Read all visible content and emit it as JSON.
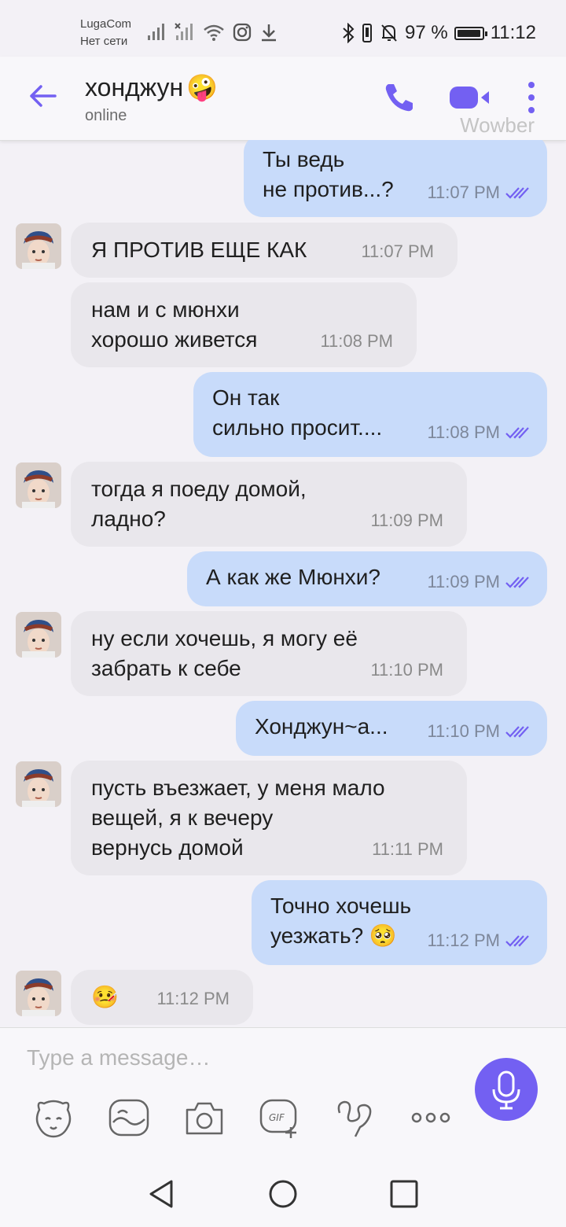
{
  "status_bar": {
    "carrier": "LugaCom",
    "network": "Нет сети",
    "battery_percent": "97 %",
    "battery_level": 0.97,
    "time": "11:12"
  },
  "header": {
    "contact_name": "хонджун",
    "name_emoji": "🤪",
    "status": "online",
    "watermark": "Wowber",
    "accent_color": "#7360f2"
  },
  "messages": [
    {
      "dir": "out",
      "text": "Ты ведь\nне против...?",
      "time": "11:07 PM",
      "read": true
    },
    {
      "dir": "in",
      "text": "Я ПРОТИВ ЕЩЕ КАК",
      "time": "11:07 PM",
      "avatar": true
    },
    {
      "dir": "in",
      "text": "нам и с мюнхи\nхорошо живется",
      "time": "11:08 PM",
      "avatar": false
    },
    {
      "dir": "out",
      "text": "Он так\nсильно просит....",
      "time": "11:08 PM",
      "read": true
    },
    {
      "dir": "in",
      "text": "тогда я поеду домой,\nладно?",
      "time": "11:09 PM",
      "avatar": true
    },
    {
      "dir": "out",
      "text": "А как же Мюнхи?",
      "time": "11:09 PM",
      "read": true
    },
    {
      "dir": "in",
      "text": "ну если хочешь, я могу её\nзабрать к себе",
      "time": "11:10 PM",
      "avatar": true
    },
    {
      "dir": "out",
      "text": "Хонджун~а...",
      "time": "11:10 PM",
      "read": true
    },
    {
      "dir": "in",
      "text": "пусть въезжает, у меня мало\nвещей, я к вечеру\nвернусь домой",
      "time": "11:11 PM",
      "avatar": true
    },
    {
      "dir": "out",
      "text": "Точно хочешь\nуезжать? 🥺",
      "time": "11:12 PM",
      "read": true
    },
    {
      "dir": "in",
      "text": "🤒",
      "time": "11:12 PM",
      "avatar": true
    }
  ],
  "composer": {
    "placeholder": "Type a message…",
    "tools": [
      "sticker-icon",
      "image-icon",
      "camera-icon",
      "gif-icon",
      "doodle-icon",
      "more-icon"
    ],
    "mic_icon": "microphone-icon"
  },
  "nav": [
    "back-triangle-icon",
    "home-circle-icon",
    "recents-square-icon"
  ]
}
